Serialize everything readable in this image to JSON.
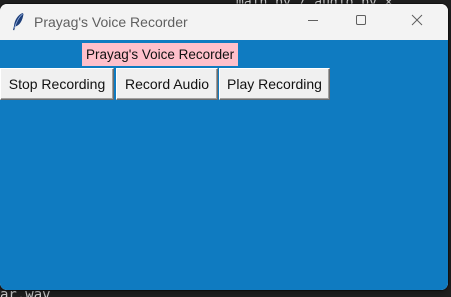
{
  "window": {
    "title": "Prayag's Voice Recorder"
  },
  "app": {
    "heading": "Prayag's Voice Recorder",
    "buttons": {
      "stop": "Stop Recording",
      "record": "Record Audio",
      "play": "Play Recording"
    }
  },
  "background": {
    "top_text": "main.py / audio.py ×",
    "bottom_text": "ar.wav"
  },
  "colors": {
    "content_bg": "#0f7bc1",
    "heading_bg": "#ffc0cb",
    "titlebar_bg": "#f3f3f3"
  },
  "icons": {
    "app": "feather-icon",
    "minimize": "minimize-icon",
    "maximize": "maximize-icon",
    "close": "close-icon"
  }
}
